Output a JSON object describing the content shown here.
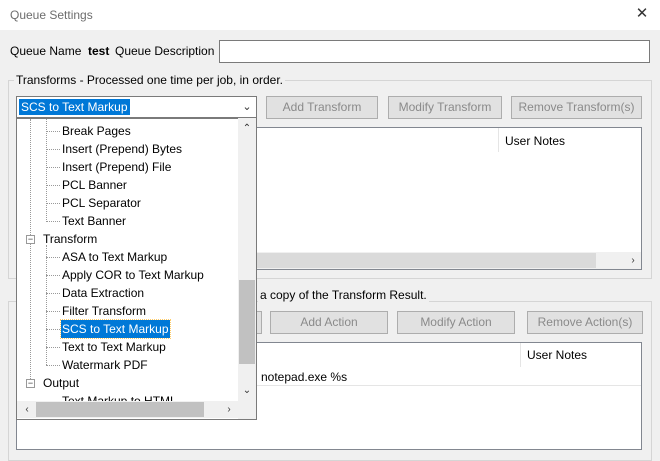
{
  "window": {
    "title": "Queue Settings"
  },
  "queue": {
    "name_label": "Queue Name",
    "name_value": "test",
    "description_label": "Queue Description",
    "description_value": ""
  },
  "transforms": {
    "group_label": "Transforms - Processed one time per job, in order.",
    "selected": "SCS to Text Markup",
    "buttons": {
      "add": "Add Transform",
      "modify": "Modify Transform",
      "remove": "Remove Transform(s)"
    },
    "list_header": {
      "user_notes": "User Notes"
    }
  },
  "actions": {
    "group_label": "a copy of the Transform Result.",
    "buttons": {
      "add": "Add Action",
      "modify": "Modify Action",
      "remove": "Remove Action(s)"
    },
    "list_header": {
      "user_notes": "User Notes"
    },
    "row_text": "notepad.exe %s"
  },
  "dropdown": {
    "items": [
      "Break Pages",
      "Insert (Prepend) Bytes",
      "Insert (Prepend) File",
      "PCL Banner",
      "PCL Separator",
      "Text Banner",
      "Transform",
      "ASA to Text Markup",
      "Apply COR to Text Markup",
      "Data Extraction",
      "Filter Transform",
      "SCS to Text Markup",
      "Text to Text Markup",
      "Watermark PDF",
      "Output",
      "Text Markup to HTML"
    ],
    "selected_index": 11
  },
  "icons": {
    "close": "close-icon",
    "combo_arrow": "chevron-down-icon",
    "scroll_up": "scroll-up-icon",
    "scroll_down": "scroll-down-icon",
    "scroll_left": "scroll-left-icon",
    "scroll_right": "scroll-right-icon",
    "expand": "expander-icon"
  },
  "colors": {
    "selection": "#0078d7",
    "window_bg": "#f0f0f0",
    "disabled_text": "#8a8a8a"
  }
}
